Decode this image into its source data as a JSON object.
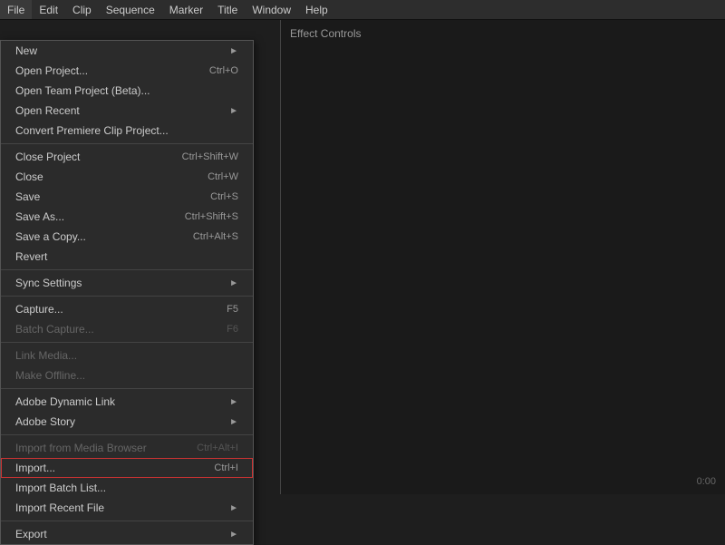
{
  "menubar": {
    "items": [
      {
        "label": "File",
        "active": true
      },
      {
        "label": "Edit"
      },
      {
        "label": "Clip"
      },
      {
        "label": "Sequence"
      },
      {
        "label": "Marker"
      },
      {
        "label": "Title"
      },
      {
        "label": "Window"
      },
      {
        "label": "Help"
      }
    ]
  },
  "file_menu": {
    "sections": [
      {
        "items": [
          {
            "label": "New",
            "shortcut": "",
            "arrow": true,
            "disabled": false
          },
          {
            "label": "Open Project...",
            "shortcut": "Ctrl+O",
            "arrow": false,
            "disabled": false
          },
          {
            "label": "Open Team Project (Beta)...",
            "shortcut": "",
            "arrow": false,
            "disabled": false
          },
          {
            "label": "Open Recent",
            "shortcut": "",
            "arrow": true,
            "disabled": false
          },
          {
            "label": "Convert Premiere Clip Project...",
            "shortcut": "",
            "arrow": false,
            "disabled": false
          }
        ]
      },
      {
        "items": [
          {
            "label": "Close Project",
            "shortcut": "Ctrl+Shift+W",
            "arrow": false,
            "disabled": false
          },
          {
            "label": "Close",
            "shortcut": "Ctrl+W",
            "arrow": false,
            "disabled": false
          },
          {
            "label": "Save",
            "shortcut": "Ctrl+S",
            "arrow": false,
            "disabled": false
          },
          {
            "label": "Save As...",
            "shortcut": "Ctrl+Shift+S",
            "arrow": false,
            "disabled": false
          },
          {
            "label": "Save a Copy...",
            "shortcut": "Ctrl+Alt+S",
            "arrow": false,
            "disabled": false
          },
          {
            "label": "Revert",
            "shortcut": "",
            "arrow": false,
            "disabled": false
          }
        ]
      },
      {
        "items": [
          {
            "label": "Sync Settings",
            "shortcut": "",
            "arrow": true,
            "disabled": false
          }
        ]
      },
      {
        "items": [
          {
            "label": "Capture...",
            "shortcut": "F5",
            "arrow": false,
            "disabled": false
          },
          {
            "label": "Batch Capture...",
            "shortcut": "F6",
            "arrow": false,
            "disabled": false
          }
        ]
      },
      {
        "items": [
          {
            "label": "Link Media...",
            "shortcut": "",
            "arrow": false,
            "disabled": false
          },
          {
            "label": "Make Offline...",
            "shortcut": "",
            "arrow": false,
            "disabled": false
          }
        ]
      },
      {
        "items": [
          {
            "label": "Adobe Dynamic Link",
            "shortcut": "",
            "arrow": true,
            "disabled": false
          },
          {
            "label": "Adobe Story",
            "shortcut": "",
            "arrow": true,
            "disabled": false
          }
        ]
      },
      {
        "items": [
          {
            "label": "Import from Media Browser",
            "shortcut": "Ctrl+Alt+I",
            "arrow": false,
            "disabled": false
          },
          {
            "label": "Import...",
            "shortcut": "Ctrl+I",
            "arrow": false,
            "disabled": false,
            "highlighted": true
          },
          {
            "label": "Import Batch List...",
            "shortcut": "",
            "arrow": false,
            "disabled": false
          },
          {
            "label": "Import Recent File",
            "shortcut": "",
            "arrow": true,
            "disabled": false
          }
        ]
      },
      {
        "items": [
          {
            "label": "Export",
            "shortcut": "",
            "arrow": true,
            "disabled": false
          }
        ]
      }
    ]
  },
  "right_panel": {
    "effect_controls_label": "Effect Controls"
  },
  "timecode": "0:00"
}
